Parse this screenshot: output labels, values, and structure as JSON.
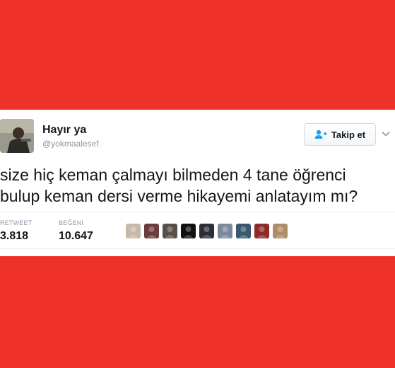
{
  "colors": {
    "background": "#ee3129",
    "card": "#ffffff",
    "text": "#14171a",
    "muted": "#8b98a5",
    "divider": "#e6ecf0",
    "twitter_blue": "#1da1f2"
  },
  "tweet": {
    "author": {
      "display_name": "Hayır ya",
      "handle": "@yokmaalesef",
      "avatar_icon": "user-avatar"
    },
    "follow_button": {
      "label": "Takip et",
      "icon": "add-user-icon"
    },
    "menu_icon": "chevron-down-icon",
    "text": "size hiç keman çalmayı bilmeden 4 tane öğrenci\nbulup keman dersi verme hikayemi anlatayım mı?",
    "stats": {
      "retweet_label": "RETWEET",
      "retweet_count": "3.818",
      "like_label": "BEĞENİ",
      "like_count": "10.647"
    },
    "likers": [
      {
        "icon": "liker-avatar",
        "color": "#c7b8a8"
      },
      {
        "icon": "liker-avatar",
        "color": "#6b3c3a"
      },
      {
        "icon": "liker-avatar",
        "color": "#5a5048"
      },
      {
        "icon": "liker-avatar",
        "color": "#111111"
      },
      {
        "icon": "liker-avatar",
        "color": "#2c2f3a"
      },
      {
        "icon": "liker-avatar",
        "color": "#7a8a9a"
      },
      {
        "icon": "liker-avatar",
        "color": "#3b5870"
      },
      {
        "icon": "liker-avatar",
        "color": "#8e2a2a"
      },
      {
        "icon": "liker-avatar",
        "color": "#b08d6a"
      }
    ]
  }
}
